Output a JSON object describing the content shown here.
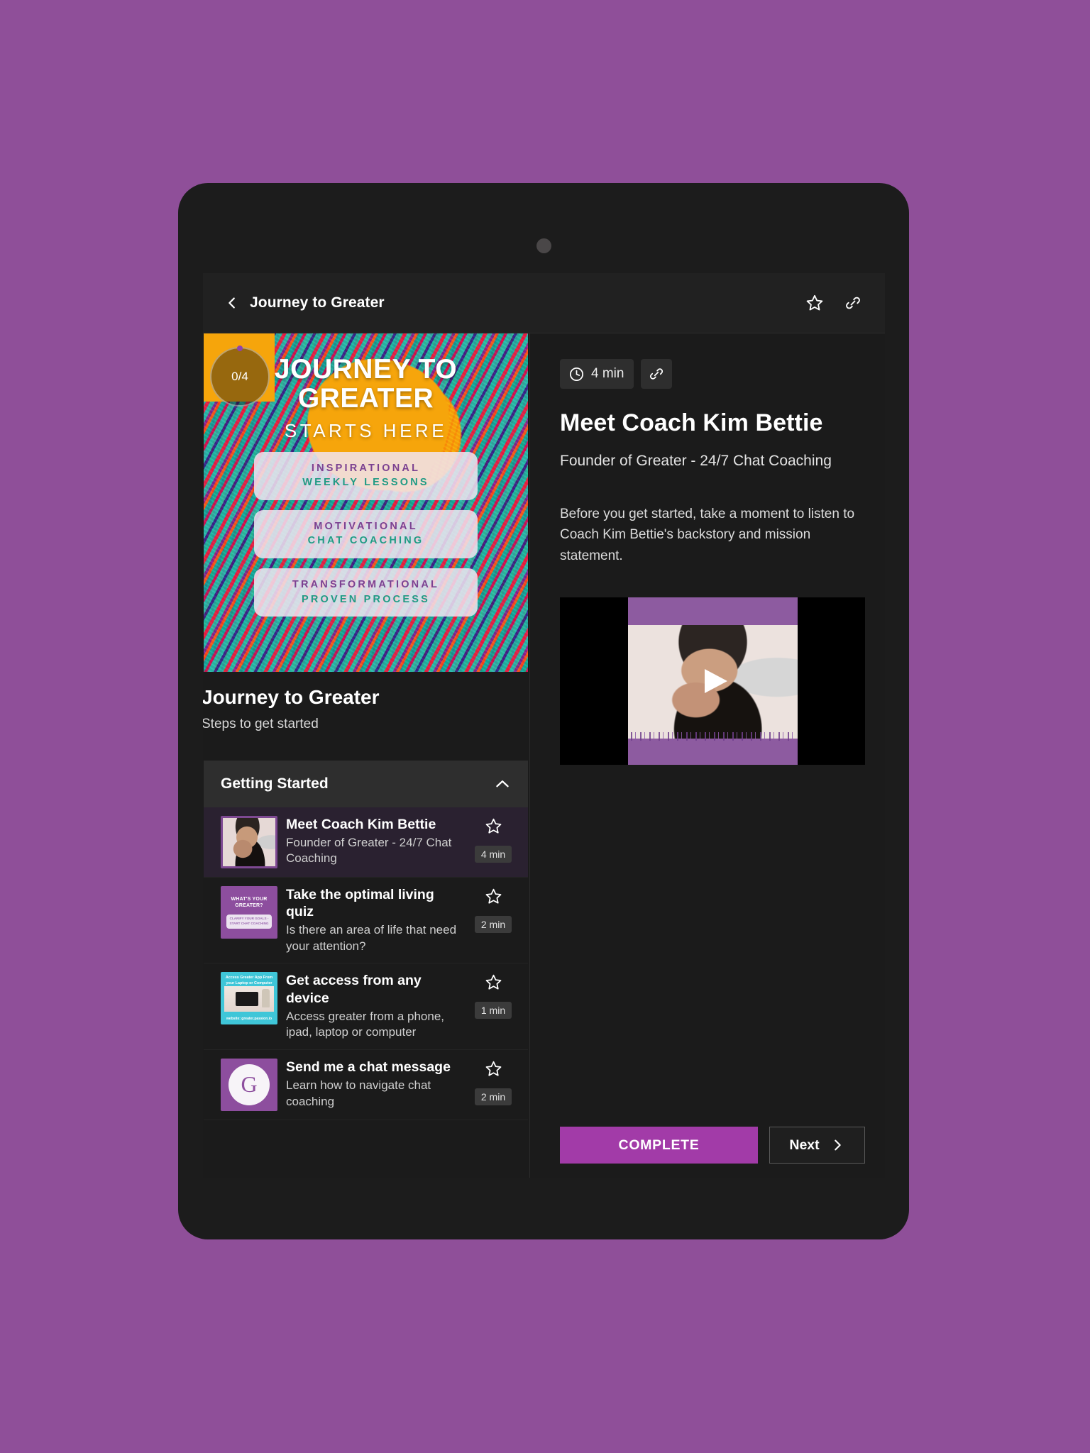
{
  "theme": {
    "page_background": "#8f4f99",
    "accent": "#a23ba8",
    "surface": "#1b1b1b",
    "surface_raised": "#2e2e2e"
  },
  "appbar": {
    "back_icon": "chevron-left-icon",
    "title": "Journey to Greater",
    "star_icon": "star-outline-icon",
    "link_icon": "link-icon"
  },
  "course": {
    "progress_label": "0/4",
    "title": "Journey to Greater",
    "subtitle": "Steps to get started",
    "cover": {
      "headline": "JOURNEY TO GREATER",
      "subhead": "STARTS HERE",
      "pills": [
        {
          "top": "INSPIRATIONAL",
          "bottom": "WEEKLY LESSONS"
        },
        {
          "top": "MOTIVATIONAL",
          "bottom": "CHAT COACHING"
        },
        {
          "top": "TRANSFORMATIONAL",
          "bottom": "PROVEN PROCESS"
        }
      ]
    }
  },
  "section": {
    "title": "Getting Started",
    "collapse_icon": "chevron-up-icon"
  },
  "lessons": [
    {
      "title": "Meet Coach Kim Bettie",
      "desc": "Founder of Greater - 24/7 Chat Coaching",
      "duration": "4 min",
      "star_icon": "star-outline-icon",
      "active": true,
      "thumb_text_top": "",
      "thumb_text_bottom": ""
    },
    {
      "title": "Take the optimal living quiz",
      "desc": "Is there an area of life that need your attention?",
      "duration": "2 min",
      "star_icon": "star-outline-icon",
      "active": false,
      "thumb_text_top": "WHAT'S YOUR GREATER?",
      "thumb_text_bottom": "CLARIFY YOUR GOALS - START CHAT COACHING"
    },
    {
      "title": "Get access from any device",
      "desc": "Access greater from a phone, ipad, laptop or computer",
      "duration": "1 min",
      "star_icon": "star-outline-icon",
      "active": false,
      "thumb_text_top": "Access Greater App From your Laptop or Computer",
      "thumb_text_bottom": "website: greater.passion.io"
    },
    {
      "title": "Send me a chat message",
      "desc": "Learn how to navigate chat coaching",
      "duration": "2 min",
      "star_icon": "star-outline-icon",
      "active": false,
      "thumb_monogram": "G",
      "thumb_text_top": "",
      "thumb_text_bottom": ""
    }
  ],
  "detail": {
    "clock_icon": "clock-icon",
    "duration": "4 min",
    "link_icon": "link-icon",
    "title": "Meet Coach Kim Bettie",
    "subtitle": "Founder of Greater - 24/7 Chat Coaching",
    "body": "Before you get started, take a moment to listen to Coach Kim Bettie's backstory and mission statement.",
    "video": {
      "play_icon": "play-icon"
    }
  },
  "footer": {
    "complete_label": "COMPLETE",
    "next_label": "Next",
    "next_icon": "chevron-right-icon"
  }
}
